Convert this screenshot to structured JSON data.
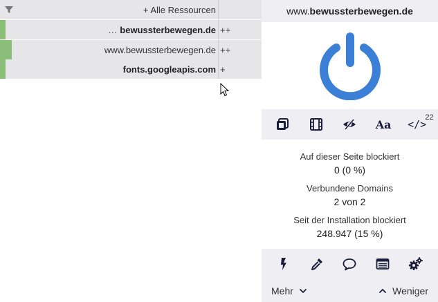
{
  "firewall": {
    "rows": [
      {
        "label": "+ Alle Ressourcen",
        "rule": "",
        "bar_fraction": 0
      },
      {
        "prefix": "…",
        "label": "bewussterbewegen.de",
        "rule": "++",
        "bar_fraction": 0.022
      },
      {
        "label": "www.bewussterbewegen.de",
        "rule": "++",
        "bar_fraction": 0.044
      },
      {
        "label": "fonts.googleapis.com",
        "rule": "+",
        "bar_fraction": 0.022
      }
    ]
  },
  "panel": {
    "hostname_prefix": "www.",
    "hostname_domain": "bewussterbewegen.de",
    "tools": {
      "font_label": "Aa",
      "script_label": "</>",
      "script_count": "22"
    },
    "stats": [
      {
        "label": "Auf dieser Seite blockiert",
        "value": "0 (0 %)"
      },
      {
        "label": "Verbundene Domains",
        "value": "2 von 2"
      },
      {
        "label": "Seit der Installation blockiert",
        "value": "248.947 (15 %)"
      }
    ],
    "footer": {
      "more_label": "Mehr",
      "less_label": "Weniger"
    }
  },
  "colors": {
    "power_blue": "#3b7fd6",
    "bar_green": "#8bbe78",
    "row_bg": "#e6e6e8",
    "panel_bg": "#eeeef3"
  },
  "icons": [
    "filter-icon",
    "power-icon",
    "element-picker-icon",
    "media-icon",
    "cosmetic-filter-icon",
    "remote-font-icon",
    "script-icon",
    "lightning-icon",
    "eyedropper-icon",
    "speech-bubble-icon",
    "logger-icon",
    "settings-icon",
    "chevron-down-icon",
    "chevron-up-icon",
    "cursor-icon"
  ]
}
